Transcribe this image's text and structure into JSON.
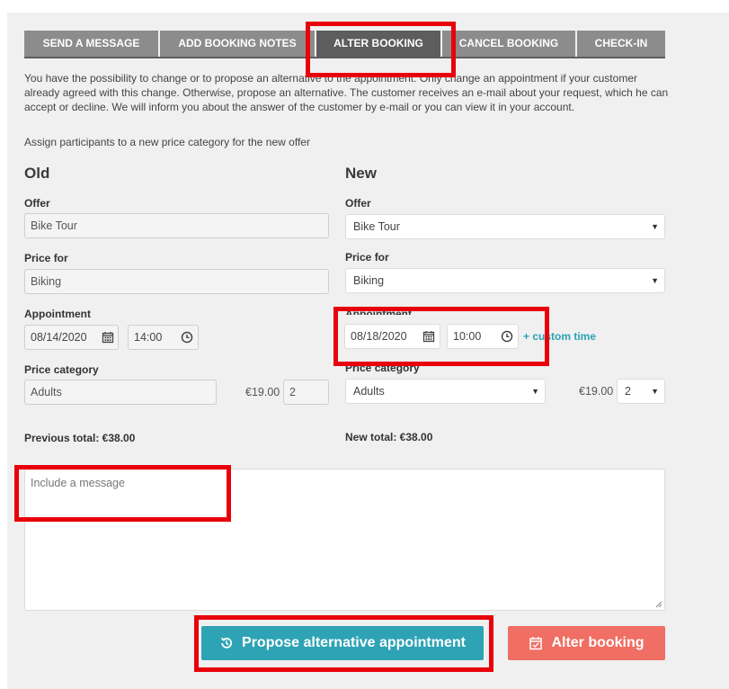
{
  "tabs": [
    {
      "label": "SEND A MESSAGE"
    },
    {
      "label": "ADD BOOKING NOTES"
    },
    {
      "label": "ALTER BOOKING"
    },
    {
      "label": "CANCEL BOOKING"
    },
    {
      "label": "CHECK-IN"
    }
  ],
  "intro": "You have the possibility to change or to propose an alternative to the appointment. Only change an appointment if your customer already agreed with this change. Otherwise, propose an alternative. The customer receives an e-mail about your request, which he can accept or decline. We will inform you about the answer of the customer by e-mail or you can view it in your account.",
  "assign_text": "Assign participants to a new price category for the new offer",
  "old": {
    "title": "Old",
    "offer_label": "Offer",
    "offer_value": "Bike Tour",
    "price_for_label": "Price for",
    "price_for_value": "Biking",
    "appointment_label": "Appointment",
    "date": "08/14/2020",
    "time": "14:00",
    "price_category_label": "Price category",
    "price_category_value": "Adults",
    "price": "€19.00",
    "quantity": "2",
    "total": "Previous total: €38.00"
  },
  "new": {
    "title": "New",
    "offer_label": "Offer",
    "offer_value": "Bike Tour",
    "price_for_label": "Price for",
    "price_for_value": "Biking",
    "appointment_label": "Appointment",
    "date": "08/18/2020",
    "time": "10:00",
    "custom_time": "+ custom time",
    "price_category_label": "Price category",
    "price_category_value": "Adults",
    "price": "€19.00",
    "quantity": "2",
    "total": "New total: €38.00"
  },
  "message": {
    "placeholder": "Include a message"
  },
  "buttons": {
    "propose": "Propose alternative appointment",
    "alter": "Alter booking"
  },
  "colors": {
    "accent_teal": "#2ea3b5",
    "accent_red": "#f06e63",
    "tab_active": "#5d5d5d",
    "tab_inactive": "#8c8c8c",
    "highlight": "#e8000b"
  }
}
